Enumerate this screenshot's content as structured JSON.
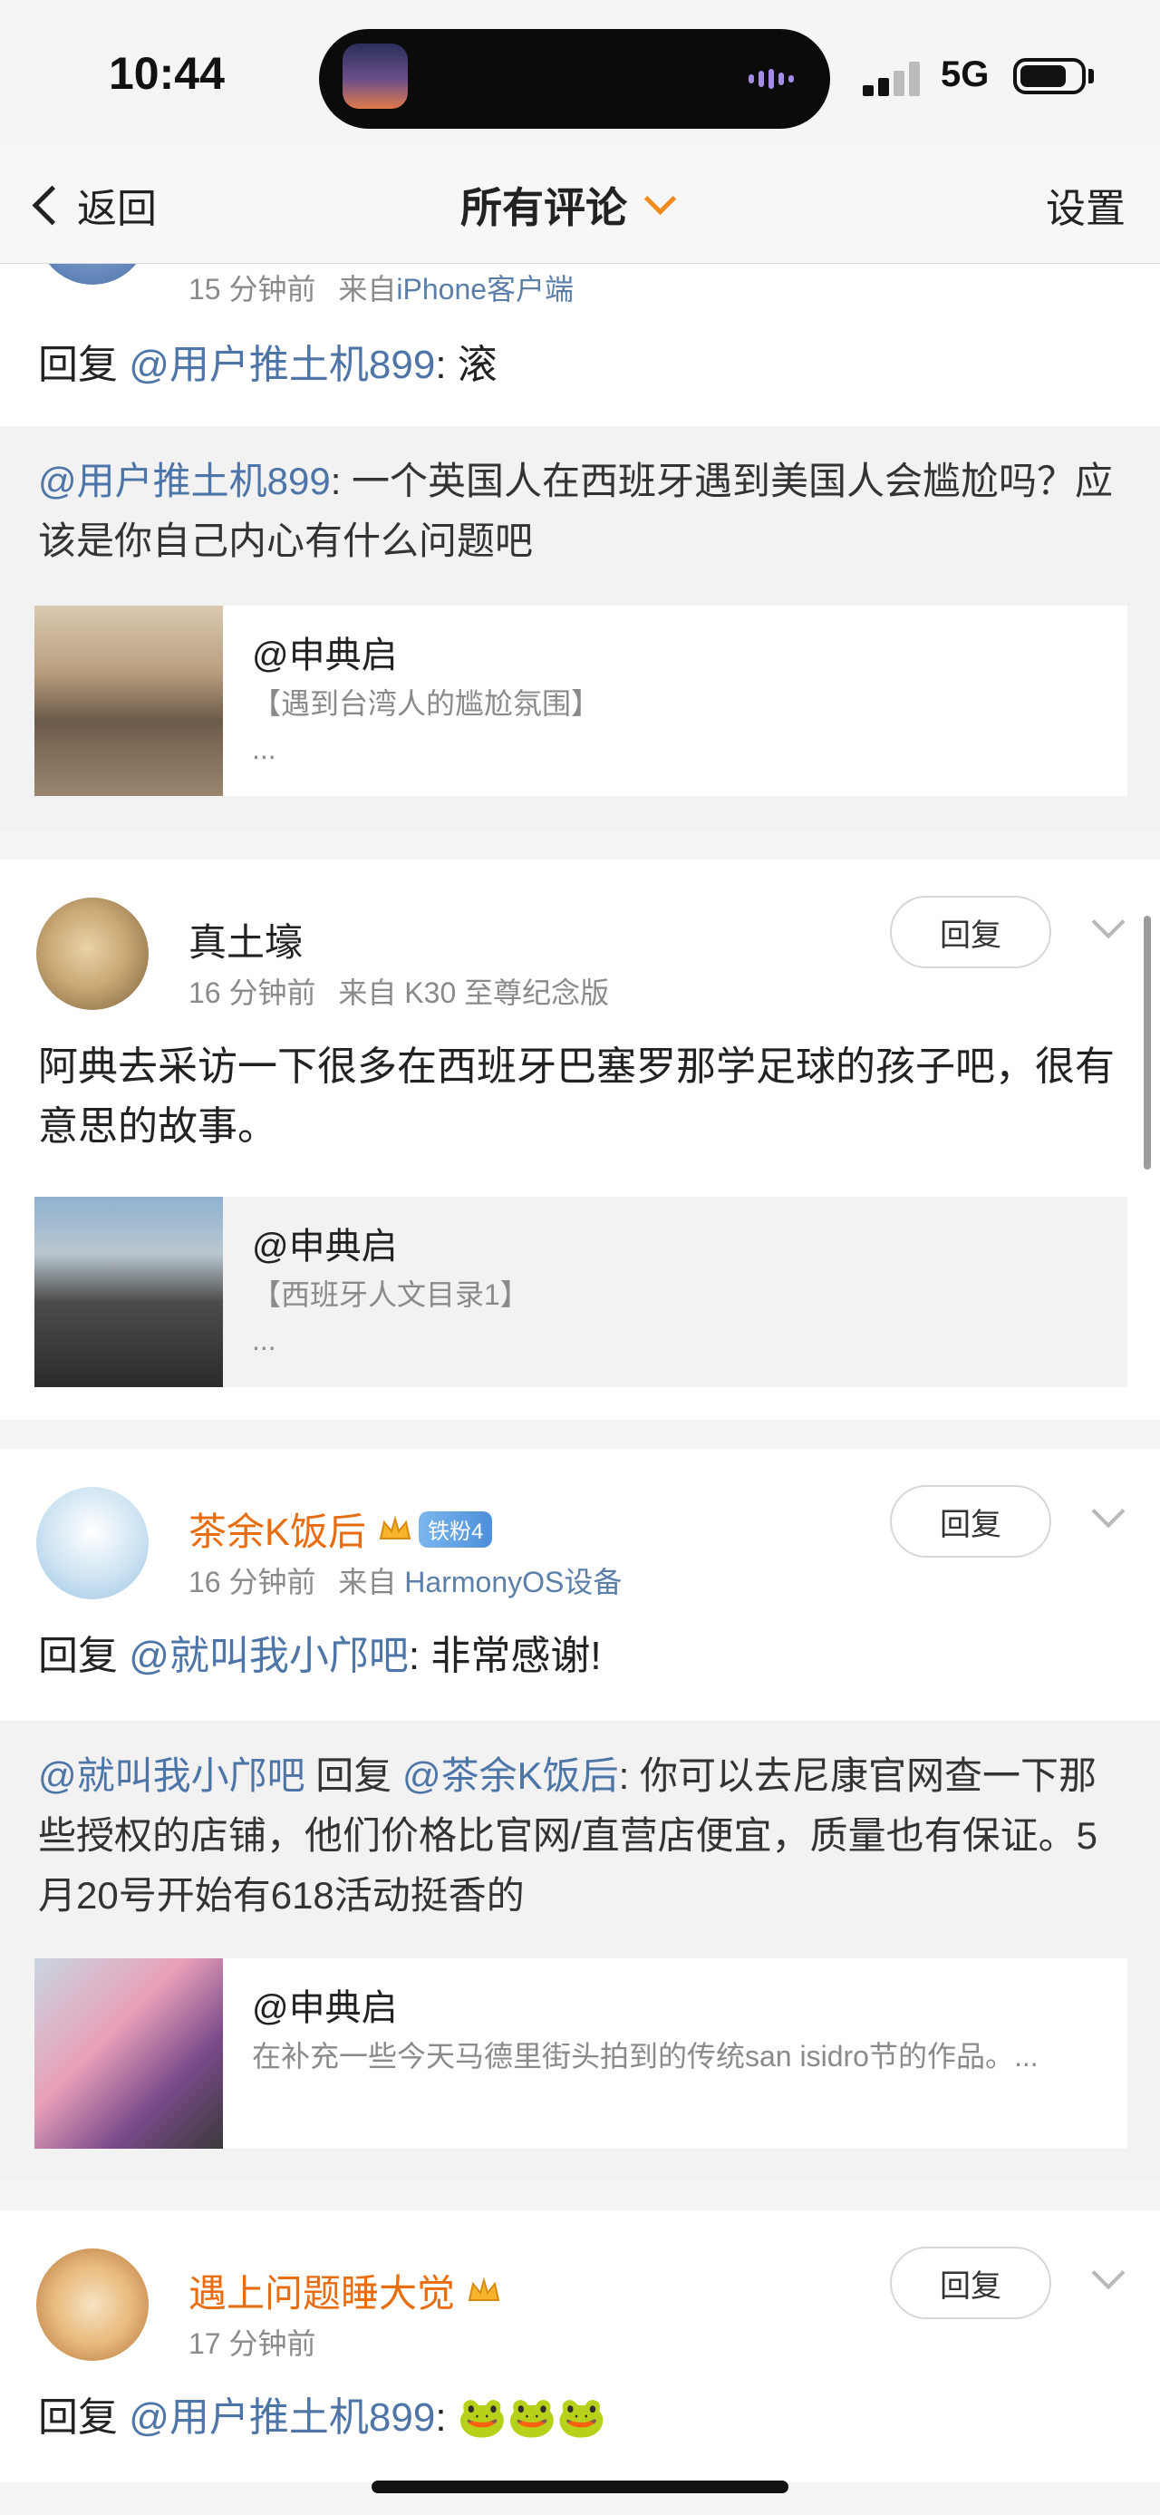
{
  "status_bar": {
    "time": "10:44",
    "network": "5G"
  },
  "nav": {
    "back_label": "返回",
    "title": "所有评论",
    "settings_label": "设置"
  },
  "comments": [
    {
      "time": "15 分钟前",
      "source_prefix": "来自",
      "source": "iPhone客户端",
      "reply_prefix": "回复",
      "mention": "@用户推土机899",
      "text": ": 滚",
      "quote": {
        "mention": "@用户推土机899",
        "text": ": 一个英国人在西班牙遇到美国人会尴尬吗？应该是你自己内心有什么问题吧"
      },
      "link_card": {
        "author": "@申典启",
        "desc": "【遇到台湾人的尴尬氛围】",
        "ellipsis": "..."
      }
    },
    {
      "name": "真土壕",
      "time": "16 分钟前",
      "source_prefix": "来自",
      "source": "K30 至尊纪念版",
      "reply_button": "回复",
      "text": "阿典去采访一下很多在西班牙巴塞罗那学足球的孩子吧，很有意思的故事。",
      "link_card": {
        "author": "@申典启",
        "desc": "【西班牙人文目录1】",
        "ellipsis": "..."
      }
    },
    {
      "name": "茶余K饭后",
      "badge": "铁粉4",
      "time": "16 分钟前",
      "source_prefix": "来自",
      "source": "HarmonyOS设备",
      "reply_button": "回复",
      "reply_prefix": "回复",
      "mention": "@就叫我小邝吧",
      "text": ": 非常感谢!",
      "quote": {
        "mention": "@就叫我小邝吧",
        "middle": " 回复 ",
        "mention2": "@茶余K饭后",
        "text": ": 你可以去尼康官网查一下那些授权的店铺，他们价格比官网/直营店便宜，质量也有保证。5月20号开始有618活动挺香的"
      },
      "link_card": {
        "author": "@申典启",
        "desc": "在补充一些今天马德里街头拍到的传统san isidro节的作品。..."
      }
    },
    {
      "name": "遇上问题睡大觉",
      "time": "17 分钟前",
      "reply_button": "回复",
      "reply_prefix": "回复",
      "mention": "@用户推土机899",
      "text": ": 🐸🐸🐸"
    }
  ],
  "colors": {
    "accent": "#f08c1c",
    "mention": "#4d75a8",
    "vip_name": "#e86c10"
  }
}
